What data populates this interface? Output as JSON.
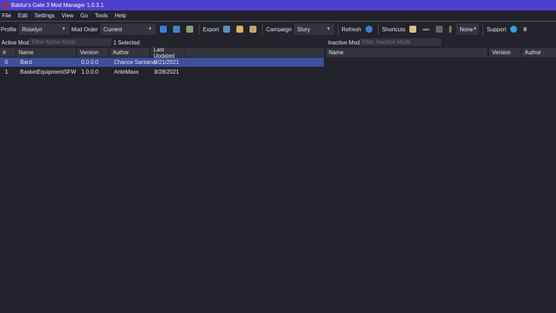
{
  "window": {
    "title": "Baldur's Gate 3 Mod Manager 1.0.3.1"
  },
  "menu": [
    "File",
    "Edit",
    "Settings",
    "View",
    "Go",
    "Tools",
    "Help"
  ],
  "toolbar": {
    "profile_label": "Profile",
    "profile_value": "Roselyn",
    "mod_order_label": "Mod Order",
    "mod_order_value": "Current",
    "export_label": "Export",
    "campaign_label": "Campaign",
    "campaign_value": "Story",
    "refresh_label": "Refresh",
    "shortcuts_label": "Shortcuts",
    "shortcut_select": "None",
    "support_label": "Support"
  },
  "active": {
    "label": "Active Mods",
    "filter_placeholder": "Filter Active Mods",
    "selected": "1 Selected",
    "columns": [
      "#",
      "Name",
      "Version",
      "Author",
      "Last Updated"
    ],
    "rows": [
      {
        "index": "0",
        "name": "Bard",
        "version": "0.0.0.0",
        "author": "Chance Santana-",
        "updated": "8/21/2021"
      },
      {
        "index": "1",
        "name": "BasketEquipmentSFW",
        "version": "1.0.0.0",
        "author": "AnteMaxx",
        "updated": "8/28/2021"
      }
    ]
  },
  "inactive": {
    "label": "Inactive Mods",
    "filter_placeholder": "Filter Inactive Mods",
    "columns": [
      "Name",
      "Version",
      "Author"
    ]
  }
}
